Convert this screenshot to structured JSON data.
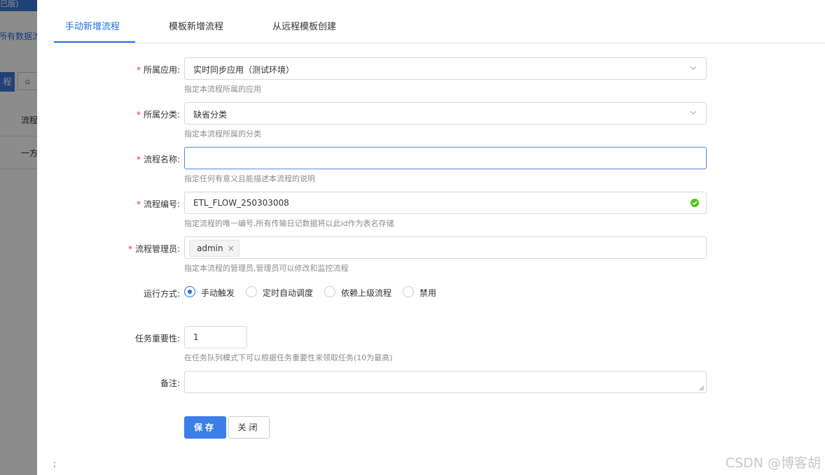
{
  "background": {
    "topbar_text": "(已版)",
    "link_text": "所有数据流",
    "primary_button": "程",
    "row1": "流程",
    "row2": "一方"
  },
  "tabs": [
    {
      "label": "手动新增流程",
      "active": true
    },
    {
      "label": "模板新增流程",
      "active": false
    },
    {
      "label": "从远程模板创建",
      "active": false
    }
  ],
  "form": {
    "app": {
      "label": "所属应用:",
      "required": true,
      "value": "实时同步应用（测试环境）",
      "help": "指定本流程所属的应用"
    },
    "category": {
      "label": "所属分类:",
      "required": true,
      "value": "缺省分类",
      "help": "指定本流程所属的分类"
    },
    "name": {
      "label": "流程名称:",
      "required": true,
      "value": "",
      "help": "指定任何有意义且能描述本流程的说明"
    },
    "code": {
      "label": "流程编号:",
      "required": true,
      "value": "ETL_FLOW_250303008",
      "help": "指定流程的唯一编号,所有传输日记数据将以此id作为表名存储"
    },
    "admin": {
      "label": "流程管理员:",
      "required": true,
      "tags": [
        "admin"
      ],
      "help": "指定本流程的管理员,管理员可以修改和监控流程"
    },
    "run_mode": {
      "label": "运行方式:",
      "options": [
        "手动触发",
        "定时自动调度",
        "依赖上级流程",
        "禁用"
      ],
      "selected": "手动触发"
    },
    "priority": {
      "label": "任务重要性:",
      "value": "1",
      "help": "在任务队列模式下可以根据任务重要性来领取任务(10为最高)"
    },
    "remark": {
      "label": "备注:",
      "value": ""
    }
  },
  "buttons": {
    "save": "保存",
    "close": "关闭"
  },
  "footer_semicolon": ";",
  "watermark": "CSDN @博客胡",
  "colors": {
    "primary": "#1f6fe0",
    "required": "#e33333",
    "success": "#52c41a"
  }
}
